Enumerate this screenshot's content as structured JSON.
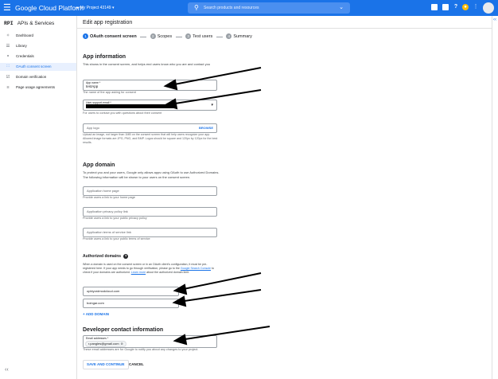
{
  "topbar": {
    "menu_icon": "menu-icon",
    "brand": "Google Cloud Platform",
    "project": "•▸ My Project 43149 ▾",
    "search_placeholder": "Search products and resources",
    "search_icon": "search-icon",
    "icons": [
      "gift-icon",
      "terminal-icon",
      "help-icon",
      "notifications-icon",
      "more-vert-icon",
      "account-avatar"
    ],
    "accent": "#1a73e8"
  },
  "sidebar": {
    "api_badge": "RPI",
    "title": "APIs & Services",
    "items": [
      {
        "icon": "dashboard-icon",
        "label": "Dashboard"
      },
      {
        "icon": "library-icon",
        "label": "Library"
      },
      {
        "icon": "key-icon",
        "label": "Credentials"
      },
      {
        "icon": "oauth-consent-icon",
        "label": "OAuth consent screen"
      },
      {
        "icon": "domain-verification-icon",
        "label": "Domain verification"
      },
      {
        "icon": "settings-icon",
        "label": "Page usage agreements"
      }
    ],
    "active_index": 3,
    "collapse_icon": "‹‹"
  },
  "main": {
    "title": "Edit app registration",
    "steps": [
      {
        "num": "1",
        "label": "OAuth consent screen"
      },
      {
        "num": "2",
        "label": "Scopes"
      },
      {
        "num": "3",
        "label": "Test users"
      },
      {
        "num": "4",
        "label": "Summary"
      }
    ]
  },
  "app_info": {
    "heading": "App information",
    "description": "This shows in the consent screen, and helps end users know who you are and contact you",
    "app_name_label": "App name *",
    "app_name_value": "testApp",
    "app_name_hint": "The name of the app asking for consent",
    "support_email_label": "User support email *",
    "support_email_hint": "For users to contact you with questions about their consent",
    "logo_placeholder": "App logo",
    "browse": "BROWSE",
    "logo_hint": "Upload an image, not larger than 1MB on the consent screen that will help users recognize your app. Allowed image formats are JPG, PNG, and BMP. Logos should be square and 120px by 120px for the best results."
  },
  "app_domain": {
    "heading": "App domain",
    "description": "To protect you and your users, Google only allows apps using OAuth to use Authorized Domains. The following information will be shown to your users on the consent screen.",
    "home_placeholder": "Application home page",
    "home_hint": "Provide users a link to your home page",
    "privacy_placeholder": "Application privacy policy link",
    "privacy_hint": "Provide users a link to your public privacy policy",
    "tos_placeholder": "Application terms of service link",
    "tos_hint": "Provide users a link to your public terms of service"
  },
  "authorized_domains": {
    "heading": "Authorized domains",
    "help_glyph": "?",
    "desc_1": "When a domain is used on the consent screen or in an OAuth client's configuration, it must be pre-registered here. If your app needs to go through verification, please go to the",
    "link_1": "Google Search Console",
    "desc_2": "to check if your domains are authorized.",
    "link_2": "Learn more",
    "desc_3": "about the authorized domain limit.",
    "domains": [
      "opbiyordmodcloud.com",
      "boingar.com"
    ],
    "add_button": "+ ADD DOMAIN"
  },
  "developer_contact": {
    "heading": "Developer contact information",
    "email_label": "Email addresses *",
    "chip": "r.pangles@gmail.com",
    "chip_remove": "⊗",
    "hint": "These email addresses are for Google to notify you about any changes to your project."
  },
  "actions": {
    "save": "SAVE AND CONTINUE",
    "cancel": "CANCEL"
  }
}
